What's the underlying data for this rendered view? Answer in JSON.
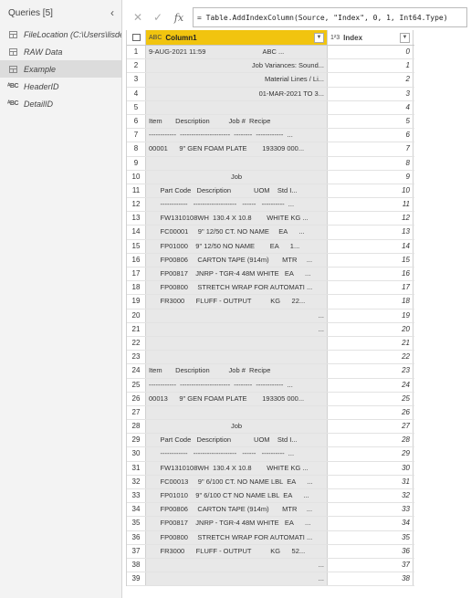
{
  "queries": {
    "title": "Queries [5]",
    "collapse_icon": "chevron-left-icon",
    "items": [
      {
        "label": "FileLocation (C:\\Users\\lisde...",
        "icon": "table-icon"
      },
      {
        "label": "RAW Data",
        "icon": "table-icon"
      },
      {
        "label": "Example",
        "icon": "table-icon"
      },
      {
        "label": "HeaderID",
        "icon": "abc-icon"
      },
      {
        "label": "DetailID",
        "icon": "abc-icon"
      }
    ],
    "selected": "Example"
  },
  "formula_bar": {
    "cancel_icon": "✕",
    "confirm_icon": "✓",
    "fx_label": "fx",
    "formula": "= Table.AddIndexColumn(Source, \"Index\", 0, 1, Int64.Type)"
  },
  "grid": {
    "col1": {
      "name": "Column1",
      "type_icon": "ABC"
    },
    "col2": {
      "name": "Index",
      "type_icon": "1²3"
    },
    "accent": "#f1c40f",
    "rows": [
      {
        "n": "1",
        "text": "9-AUG-2021 11:59                              ABC ...",
        "align": "left",
        "idx": "0"
      },
      {
        "n": "2",
        "text": "Job Variances: Sound...",
        "align": "right",
        "idx": "1"
      },
      {
        "n": "3",
        "text": "Material Lines / Li...",
        "align": "right",
        "idx": "2"
      },
      {
        "n": "4",
        "text": "01-MAR-2021 TO 3...",
        "align": "right",
        "idx": "3"
      },
      {
        "n": "5",
        "text": "",
        "align": "right",
        "idx": "4"
      },
      {
        "n": "6",
        "text": "Item       Description          Job #  Recipe",
        "align": "left",
        "idx": "5"
      },
      {
        "n": "7",
        "text": "------------  ----------------------  --------  ------------  ...",
        "align": "left",
        "idx": "6"
      },
      {
        "n": "8",
        "text": "00001      9\" GEN FOAM PLATE        193309 000...",
        "align": "left",
        "idx": "7"
      },
      {
        "n": "9",
        "text": "",
        "align": "right",
        "idx": "8"
      },
      {
        "n": "10",
        "text": "Job",
        "align": "center",
        "idx": "9"
      },
      {
        "n": "11",
        "text": "      Part Code   Description            UOM    Std I...",
        "align": "left",
        "idx": "10"
      },
      {
        "n": "12",
        "text": "      ------------   -------------------   ------   ----------  ...",
        "align": "left",
        "idx": "11"
      },
      {
        "n": "13",
        "text": "      FW1310108WH  130.4 X 10.8        WHITE KG ...",
        "align": "left",
        "idx": "12"
      },
      {
        "n": "14",
        "text": "      FC00001     9\" 12/50 CT. NO NAME     EA      ...",
        "align": "left",
        "idx": "13"
      },
      {
        "n": "15",
        "text": "      FP01000    9\" 12/50 NO NAME        EA      1...",
        "align": "left",
        "idx": "14"
      },
      {
        "n": "16",
        "text": "      FP00806     CARTON TAPE (914m)       MTR     ...",
        "align": "left",
        "idx": "15"
      },
      {
        "n": "17",
        "text": "      FP00817    JNRP - TGR-4 48M WHITE   EA      ...",
        "align": "left",
        "idx": "16"
      },
      {
        "n": "18",
        "text": "      FP00800     STRETCH WRAP FOR AUTOMATI ...",
        "align": "left",
        "idx": "17"
      },
      {
        "n": "19",
        "text": "      FR3000      FLUFF - OUTPUT          KG      22...",
        "align": "left",
        "idx": "18"
      },
      {
        "n": "20",
        "text": "...",
        "align": "right",
        "idx": "19"
      },
      {
        "n": "21",
        "text": "...",
        "align": "right",
        "idx": "20"
      },
      {
        "n": "22",
        "text": "",
        "align": "right",
        "idx": "21"
      },
      {
        "n": "23",
        "text": "",
        "align": "right",
        "idx": "22"
      },
      {
        "n": "24",
        "text": "Item       Description          Job #  Recipe",
        "align": "left",
        "idx": "23"
      },
      {
        "n": "25",
        "text": "------------  ----------------------  --------  ------------  ...",
        "align": "left",
        "idx": "24"
      },
      {
        "n": "26",
        "text": "00013      9\" GEN FOAM PLATE        193305 000...",
        "align": "left",
        "idx": "25"
      },
      {
        "n": "27",
        "text": "",
        "align": "right",
        "idx": "26"
      },
      {
        "n": "28",
        "text": "Job",
        "align": "center",
        "idx": "27"
      },
      {
        "n": "29",
        "text": "      Part Code   Description            UOM    Std I...",
        "align": "left",
        "idx": "28"
      },
      {
        "n": "30",
        "text": "      ------------   -------------------   ------   ----------  ...",
        "align": "left",
        "idx": "29"
      },
      {
        "n": "31",
        "text": "      FW1310108WH  130.4 X 10.8        WHITE KG ...",
        "align": "left",
        "idx": "30"
      },
      {
        "n": "32",
        "text": "      FC00013     9\" 6/100 CT. NO NAME LBL  EA      ...",
        "align": "left",
        "idx": "31"
      },
      {
        "n": "33",
        "text": "      FP01010    9\" 6/100 CT NO NAME LBL  EA      ...",
        "align": "left",
        "idx": "32"
      },
      {
        "n": "34",
        "text": "      FP00806     CARTON TAPE (914m)       MTR     ...",
        "align": "left",
        "idx": "33"
      },
      {
        "n": "35",
        "text": "      FP00817    JNRP - TGR-4 48M WHITE   EA      ...",
        "align": "left",
        "idx": "34"
      },
      {
        "n": "36",
        "text": "      FP00800     STRETCH WRAP FOR AUTOMATI ...",
        "align": "left",
        "idx": "35"
      },
      {
        "n": "37",
        "text": "      FR3000      FLUFF - OUTPUT          KG      52...",
        "align": "left",
        "idx": "36"
      },
      {
        "n": "38",
        "text": "...",
        "align": "right",
        "idx": "37"
      },
      {
        "n": "39",
        "text": "...",
        "align": "right",
        "idx": "38"
      }
    ]
  }
}
